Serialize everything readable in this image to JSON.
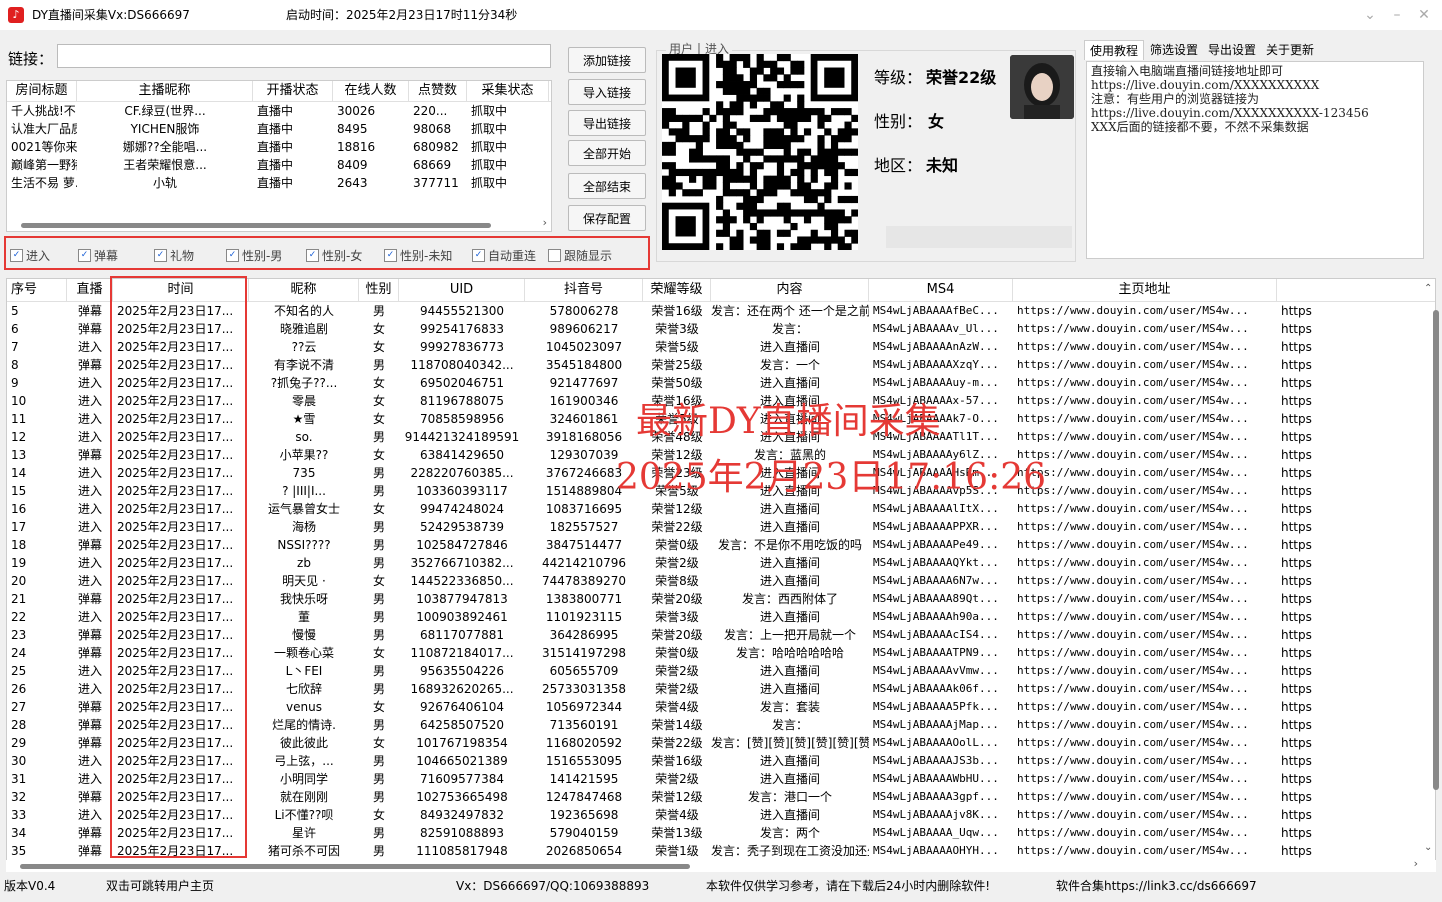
{
  "window": {
    "title": "DY直播间采集Vx:DS666697",
    "start_time": "启动时间：2025年2月23日17时11分34秒",
    "icon": "douyin-icon"
  },
  "link": {
    "label": "链接：",
    "value": ""
  },
  "room_list": {
    "columns": [
      "房间标题",
      "主播昵称",
      "开播状态",
      "在线人数",
      "点赞数",
      "采集状态"
    ],
    "rows": [
      [
        "千人挑战!不...",
        "CF.绿豆(世界...",
        "直播中",
        "30026",
        "220...",
        "抓取中"
      ],
      [
        "认准大厂品质...",
        "YICHEN服饰",
        "直播中",
        "8495",
        "98068",
        "抓取中"
      ],
      [
        "0021等你来",
        "娜娜??全能唱...",
        "直播中",
        "18816",
        "680982",
        "抓取中"
      ],
      [
        "巅峰第一野猪...",
        "王者荣耀恨意...",
        "直播中",
        "8409",
        "68669",
        "抓取中"
      ],
      [
        "生活不易 萝...",
        "小轨",
        "直播中",
        "2643",
        "377711",
        "抓取中"
      ]
    ]
  },
  "buttons": [
    "添加链接",
    "导入链接",
    "导出链接",
    "全部开始",
    "全部结束",
    "保存配置"
  ],
  "user": {
    "group_label": "用户丨进入",
    "level_label": "等级：",
    "level_value": "荣誉22级",
    "gender_label": "性别：",
    "gender_value": "女",
    "region_label": "地区：",
    "region_value": "未知"
  },
  "tabs": [
    "使用教程",
    "筛选设置",
    "导出设置",
    "关于更新"
  ],
  "tutorial_lines": [
    "直接输入电脑端直播间链接地址即可",
    "https://live.douyin.com/XXXXXXXXXX",
    "注意：有些用户的浏览器链接为",
    "https://live.douyin.com/XXXXXXXXXX-123456",
    "XXX后面的链接都不要，不然不采集数据"
  ],
  "filters": [
    {
      "label": "进入",
      "checked": true
    },
    {
      "label": "弹幕",
      "checked": true
    },
    {
      "label": "礼物",
      "checked": true
    },
    {
      "label": "性别-男",
      "checked": true
    },
    {
      "label": "性别-女",
      "checked": true
    },
    {
      "label": "性别-未知",
      "checked": true
    },
    {
      "label": "自动重连",
      "checked": true
    },
    {
      "label": "跟随显示",
      "checked": false
    }
  ],
  "table": {
    "columns": [
      "序号",
      "直播",
      "时间",
      "昵称",
      "性别",
      "UID",
      "抖音号",
      "荣耀等级",
      "内容",
      "MS4",
      "主页地址"
    ],
    "rows": [
      [
        "5",
        "弹幕",
        "2025年2月23日17...",
        "不知名的人",
        "男",
        "94455521300",
        "578006278",
        "荣誉16级",
        "发言：还在两个  还一个是之前的",
        "MS4wLjABAAAAfBeC...",
        "https://www.douyin.com/user/MS4w...",
        "https"
      ],
      [
        "6",
        "弹幕",
        "2025年2月23日17...",
        "晓雅追剧",
        "女",
        "99254176833",
        "989606217",
        "荣誉3级",
        "发言：",
        "MS4wLjABAAAAv_Ul...",
        "https://www.douyin.com/user/MS4w...",
        "https"
      ],
      [
        "7",
        "进入",
        "2025年2月23日17...",
        "??云",
        "女",
        "99927836773",
        "1045023097",
        "荣誉5级",
        "进入直播间",
        "MS4wLjABAAAAnAzW...",
        "https://www.douyin.com/user/MS4w...",
        "https"
      ],
      [
        "8",
        "弹幕",
        "2025年2月23日17...",
        "有李说不清",
        "男",
        "118708040342...",
        "3545184800",
        "荣誉25级",
        "发言：一个",
        "MS4wLjABAAAAXzqY...",
        "https://www.douyin.com/user/MS4w...",
        "https"
      ],
      [
        "9",
        "进入",
        "2025年2月23日17...",
        "?抓兔子??...",
        "女",
        "69502046751",
        "921477697",
        "荣誉50级",
        "进入直播间",
        "MS4wLjABAAAAuy-m...",
        "https://www.douyin.com/user/MS4w...",
        "https"
      ],
      [
        "10",
        "进入",
        "2025年2月23日17...",
        "零晨",
        "女",
        "81196788075",
        "161900346",
        "荣誉16级",
        "进入直播间",
        "MS4wLjABAAAAx-57...",
        "https://www.douyin.com/user/MS4w...",
        "https"
      ],
      [
        "11",
        "进入",
        "2025年2月23日17...",
        "★雪",
        "女",
        "70858598956",
        "324601861",
        "荣誉5级",
        "进入直播间",
        "MS4wLjABAAAAk7-O...",
        "https://www.douyin.com/user/MS4w...",
        "https"
      ],
      [
        "12",
        "进入",
        "2025年2月23日17...",
        "so.",
        "男",
        "914421324189591",
        "3918168056",
        "荣誉48级",
        "进入直播间",
        "MS4wLjABAAAATl1T...",
        "https://www.douyin.com/user/MS4w...",
        "https"
      ],
      [
        "13",
        "弹幕",
        "2025年2月23日17...",
        "小苹果??",
        "女",
        "63841429650",
        "129307039",
        "荣誉12级",
        "发言：蓝黑的",
        "MS4wLjABAAAAy6lZ...",
        "https://www.douyin.com/user/MS4w...",
        "https"
      ],
      [
        "14",
        "进入",
        "2025年2月23日17...",
        "735",
        "男",
        "228220760385...",
        "3767246683",
        "荣誉23级",
        "进入直播间",
        "MS4wLjABAAAAHsRm...",
        "https://www.douyin.com/user/MS4w...",
        "https"
      ],
      [
        "15",
        "进入",
        "2025年2月23日17...",
        "? |III|I...",
        "男",
        "103360393117",
        "1514889804",
        "荣誉5级",
        "进入直播间",
        "MS4wLjABAAAAvp5S...",
        "https://www.douyin.com/user/MS4w...",
        "https"
      ],
      [
        "16",
        "进入",
        "2025年2月23日17...",
        "运气暴曾女士",
        "女",
        "99474248024",
        "1083716695",
        "荣誉12级",
        "进入直播间",
        "MS4wLjABAAAAlItX...",
        "https://www.douyin.com/user/MS4w...",
        "https"
      ],
      [
        "17",
        "进入",
        "2025年2月23日17...",
        "海杨",
        "男",
        "52429538739",
        "182557527",
        "荣誉22级",
        "进入直播间",
        "MS4wLjABAAAAPPXR...",
        "https://www.douyin.com/user/MS4w...",
        "https"
      ],
      [
        "18",
        "弹幕",
        "2025年2月23日17...",
        "NSSI????",
        "男",
        "102584727846",
        "3847514477",
        "荣誉0级",
        "发言：不是你不用吃饭的吗",
        "MS4wLjABAAAAPe49...",
        "https://www.douyin.com/user/MS4w...",
        "https"
      ],
      [
        "19",
        "进入",
        "2025年2月23日17...",
        "zb",
        "男",
        "352766710382...",
        "44214210796",
        "荣誉2级",
        "进入直播间",
        "MS4wLjABAAAAQYkt...",
        "https://www.douyin.com/user/MS4w...",
        "https"
      ],
      [
        "20",
        "进入",
        "2025年2月23日17...",
        "明天见 ·",
        "女",
        "144522336850...",
        "74478389270",
        "荣誉8级",
        "进入直播间",
        "MS4wLjABAAAA6N7w...",
        "https://www.douyin.com/user/MS4w...",
        "https"
      ],
      [
        "21",
        "弹幕",
        "2025年2月23日17...",
        "我快乐呀",
        "男",
        "103877947813",
        "1383800771",
        "荣誉20级",
        "发言：西西附体了",
        "MS4wLjABAAAA89Qt...",
        "https://www.douyin.com/user/MS4w...",
        "https"
      ],
      [
        "22",
        "进入",
        "2025年2月23日17...",
        "董",
        "男",
        "100903892461",
        "1101923115",
        "荣誉3级",
        "进入直播间",
        "MS4wLjABAAAAh90a...",
        "https://www.douyin.com/user/MS4w...",
        "https"
      ],
      [
        "23",
        "弹幕",
        "2025年2月23日17...",
        "慢慢",
        "男",
        "68117077881",
        "364286995",
        "荣誉20级",
        "发言：上一把开局就一个",
        "MS4wLjABAAAAcIS4...",
        "https://www.douyin.com/user/MS4w...",
        "https"
      ],
      [
        "24",
        "弹幕",
        "2025年2月23日17...",
        "一颗卷心菜",
        "女",
        "110872184017...",
        "31514197298",
        "荣誉0级",
        "发言：哈哈哈哈哈哈",
        "MS4wLjABAAAATPN9...",
        "https://www.douyin.com/user/MS4w...",
        "https"
      ],
      [
        "25",
        "进入",
        "2025年2月23日17...",
        "L丶FEI",
        "男",
        "95635504226",
        "605655709",
        "荣誉2级",
        "进入直播间",
        "MS4wLjABAAAAvVmw...",
        "https://www.douyin.com/user/MS4w...",
        "https"
      ],
      [
        "26",
        "进入",
        "2025年2月23日17...",
        "七欣辞",
        "男",
        "168932620265...",
        "25733031358",
        "荣誉2级",
        "进入直播间",
        "MS4wLjABAAAAk06f...",
        "https://www.douyin.com/user/MS4w...",
        "https"
      ],
      [
        "27",
        "弹幕",
        "2025年2月23日17...",
        "venus",
        "女",
        "92676406104",
        "1056972344",
        "荣誉4级",
        "发言：套装",
        "MS4wLjABAAAA5Pfk...",
        "https://www.douyin.com/user/MS4w...",
        "https"
      ],
      [
        "28",
        "弹幕",
        "2025年2月23日17...",
        "烂尾的情诗.",
        "男",
        "64258507520",
        "713560191",
        "荣誉14级",
        "发言：",
        "MS4wLjABAAAAjMap...",
        "https://www.douyin.com/user/MS4w...",
        "https"
      ],
      [
        "29",
        "弹幕",
        "2025年2月23日17...",
        "彼此彼此",
        "女",
        "101767198354",
        "1168020592",
        "荣誉22级",
        "发言：[赞][赞][赞][赞][赞][赞][...",
        "MS4wLjABAAAAOolL...",
        "https://www.douyin.com/user/MS4w...",
        "https"
      ],
      [
        "30",
        "进入",
        "2025年2月23日17...",
        "弓上弦，...",
        "男",
        "104665021389",
        "1516553095",
        "荣誉16级",
        "进入直播间",
        "MS4wLjABAAAAJS3b...",
        "https://www.douyin.com/user/MS4w...",
        "https"
      ],
      [
        "31",
        "进入",
        "2025年2月23日17...",
        "小明同学",
        "男",
        "71609577384",
        "141421595",
        "荣誉2级",
        "进入直播间",
        "MS4wLjABAAAAWbHU...",
        "https://www.douyin.com/user/MS4w...",
        "https"
      ],
      [
        "32",
        "弹幕",
        "2025年2月23日17...",
        "就在刚刚",
        "男",
        "102753665498",
        "1247847468",
        "荣誉12级",
        "发言：港口一个",
        "MS4wLjABAAAA3gpf...",
        "https://www.douyin.com/user/MS4w...",
        "https"
      ],
      [
        "33",
        "进入",
        "2025年2月23日17...",
        "Li不懂??呗",
        "女",
        "84932497832",
        "192365698",
        "荣誉4级",
        "进入直播间",
        "MS4wLjABAAAAjv8K...",
        "https://www.douyin.com/user/MS4w...",
        "https"
      ],
      [
        "34",
        "弹幕",
        "2025年2月23日17...",
        "星许",
        "男",
        "82591088893",
        "579040159",
        "荣誉13级",
        "发言：两个",
        "MS4wLjABAAAA_Uqw...",
        "https://www.douyin.com/user/MS4w...",
        "https"
      ],
      [
        "35",
        "弹幕",
        "2025年2月23日17...",
        "猪可杀不可因",
        "男",
        "111085817948",
        "2026850654",
        "荣誉1级",
        "发言：秃子到现在工资没加还少了[...",
        "MS4wLjABAAAAOHYH...",
        "https://www.douyin.com/user/MS4w...",
        "https"
      ]
    ]
  },
  "watermark": {
    "line1": "最新DY直播间采集",
    "line2": "2025年2月23日17:16:26"
  },
  "status": {
    "version": "版本V0.4",
    "hint": "双击可跳转用户主页",
    "contact": "Vx：DS666697/QQ:1069388893",
    "notice": "本软件仅供学习参考，请在下载后24小时内删除软件!",
    "collection": "软件合集https://link3.cc/ds666697"
  },
  "colors": {
    "highlight_red": "#e53935",
    "accent": "#1a5fd6"
  }
}
